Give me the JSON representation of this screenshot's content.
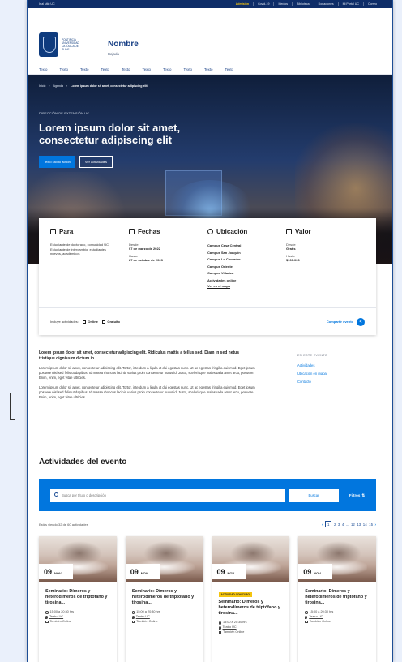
{
  "topbar": {
    "home": "Ir al sitio UC",
    "links": [
      "Admisión",
      "Covid-19",
      "Medios",
      "Biblioteca",
      "Donaciones",
      "Mi Portal UC",
      "Correo"
    ]
  },
  "header": {
    "logo_text": "PONTIFICIA UNIVERSIDAD CATÓLICA DE CHILE",
    "site_name": "Nombre",
    "site_sub": "Bajada",
    "nav": [
      "Texto",
      "Texto",
      "Texto",
      "Texto",
      "Texto",
      "Texto",
      "Texto",
      "Texto",
      "Texto",
      "Texto"
    ]
  },
  "hero": {
    "breadcrumb": [
      "Inicio",
      "Agenda",
      "Lorem ipsum dolor sit amet, consectetur adipiscing elit"
    ],
    "eyebrow": "DIRECCIÓN DE EXTENSIÓN UC",
    "title": "Lorem ipsum dolor sit amet, consectetur adipiscing elit",
    "cta_primary": "Texto call to action",
    "cta_secondary": "Ver actividades"
  },
  "info": {
    "para": {
      "title": "Para",
      "text": "Estudiante de doctorado, comunidad UC, Estudiante de intercambio, estudiantes nuevos, académicos"
    },
    "fechas": {
      "title": "Fechas",
      "desde_label": "Desde",
      "desde": "07 de marzo de 2022",
      "hasta_label": "Hasta",
      "hasta": "27 de octubre de 2023"
    },
    "ubicacion": {
      "title": "Ubicación",
      "campus": [
        "Campus Casa Central",
        "Campus San Joaquín",
        "Campus Lo Contador",
        "Campus Oriente",
        "Campus Villarica",
        "Actividades online"
      ],
      "map_link": "Ver en el mapa"
    },
    "valor": {
      "title": "Valor",
      "desde_label": "Desde",
      "desde": "Gratis",
      "hasta_label": "Hasta",
      "hasta": "$100.000"
    },
    "footer": {
      "includes": "Incluye actividades:",
      "tag1": "Online",
      "tag2": "Gratuito",
      "share": "Compartir evento"
    }
  },
  "body": {
    "lead": "Lorem ipsum dolor sit amet, consectetur adipiscing elit. Ridiculus mattis a tellus sed. Diam in sed netus tristique dignissim dictum in.",
    "p1": "Lorem ipsum dolor sit amet, consectetur adipiscing elit. Tortor, interdum a ligula ut dui egestas nunc. Ut ac egestas fringilla euismod. Eget ipsum posuere nisl sed felis ut dapibus. Id massa rhoncus lacinia varius proin consectetur purus id. Justo, scelerisque malesuada amet arcu, posuere. Enim, enim, eget vitae ultricies.",
    "p2": "Lorem ipsum dolor sit amet, consectetur adipiscing elit. Tortor, interdum a ligula ut dui egestas nunc. Ut ac egestas fringilla euismod. Eget ipsum posuere nisl sed felis ut dapibus. Id massa rhoncus lacinia varius proin consectetur purus id. Justo, scelerisque malesuada amet arcu, posuere. Enim, enim, eget vitae ultricies."
  },
  "aside": {
    "heading": "EN ESTE EVENTO",
    "links": [
      "Actividades",
      "Ubicación en mapa",
      "Contacto"
    ]
  },
  "activities": {
    "title": "Actividades del evento",
    "search_placeholder": "Busca por título o descripción",
    "search_button": "Buscar",
    "filters": "Filtros",
    "results": "Estás viendo 32 de 60 actividades",
    "pages": [
      "1",
      "2",
      "3",
      "4",
      "...",
      "12",
      "13",
      "14",
      "15"
    ],
    "cards": [
      {
        "day": "09",
        "month": "NOV",
        "pill": "",
        "title": "Seminario: Dímeros y heterodímeros de triptófano y tirosina...",
        "time": "15:00 a 20:30 hrs",
        "place": "Teatro UC",
        "mode": "También Online"
      },
      {
        "day": "09",
        "month": "NOV",
        "pill": "",
        "title": "Seminario: Dímeros y heterodímeros de triptófano y tirosina...",
        "time": "15:00 a 20:30 hrs",
        "place": "Teatro UC",
        "mode": "También Online"
      },
      {
        "day": "09",
        "month": "NOV",
        "pill": "ACTIVIDAD CON CUPO",
        "title": "Seminario: Dímeros y heterodímeros de triptófano y tirosina...",
        "time": "15:00 a 20:30 hrs",
        "place": "Teatro UC",
        "mode": "También Online"
      },
      {
        "day": "09",
        "month": "NOV",
        "pill": "",
        "title": "Seminario: Dímeros y heterodímeros de triptófano y tirosina...",
        "time": "15:00 a 20:30 hrs",
        "place": "Teatro UC",
        "mode": "También Online"
      }
    ]
  },
  "colors": {
    "primary": "#0176de",
    "navy": "#0e2d68",
    "accent": "#f4c40f"
  }
}
